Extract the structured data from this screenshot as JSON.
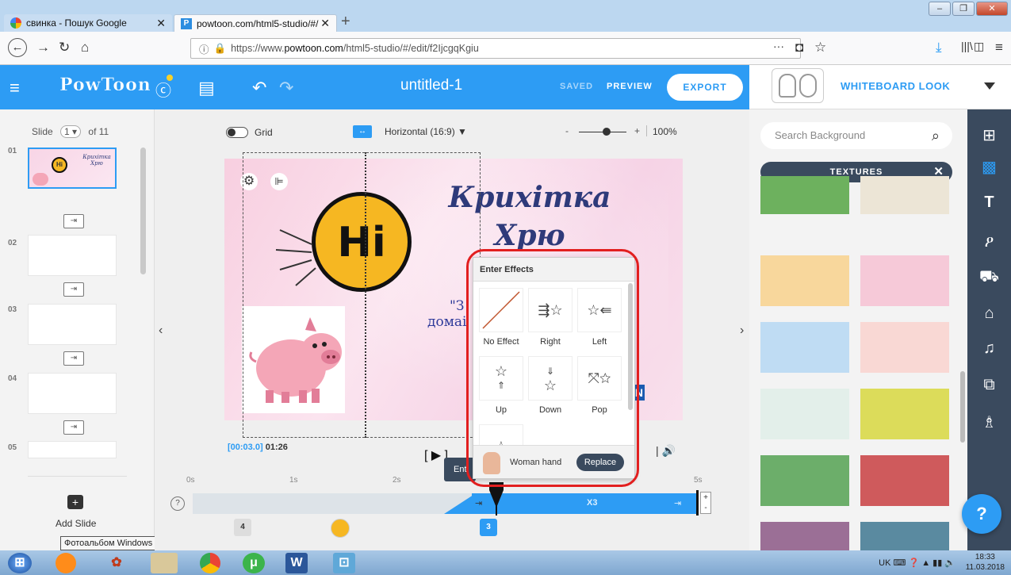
{
  "browser": {
    "tabs": [
      {
        "title": "свинка - Пошук Google"
      },
      {
        "title": "powtoon.com/html5-studio/#/"
      }
    ],
    "url_prefix": "https://www.",
    "url_domain": "powtoon.com",
    "url_path": "/html5-studio/#/edit/f2IjcgqKgiu",
    "new_tab": "+",
    "win_controls": [
      "–",
      "❐",
      "✕"
    ],
    "nav_icons": [
      "back-icon",
      "forward-icon",
      "reload-icon",
      "home-icon"
    ],
    "right_icons": [
      "···",
      "pocket-icon",
      "star-icon",
      "download-icon",
      "library-icon",
      "sidebar-icon",
      "menu-icon"
    ]
  },
  "header": {
    "logo": "PowToon",
    "title": "untitled-1",
    "saved": "SAVED",
    "preview": "PREVIEW",
    "export": "EXPORT",
    "look": "WHITEBOARD LOOK"
  },
  "slides": {
    "label": "Slide",
    "current": "1",
    "of": "of 11",
    "items": [
      "01",
      "02",
      "03",
      "04",
      "05"
    ],
    "add_label": "Add Slide",
    "tooltip": "Фотоальбом Windows Live"
  },
  "toolbar": {
    "grid": "Grid",
    "orientation": "Horizontal (16:9)",
    "zoom_minus": "-",
    "zoom_plus": "+",
    "zoom": "100%"
  },
  "slide": {
    "title_line1": "Крихітка",
    "title_line2": "Хрю",
    "hi": "Hi",
    "sub_line1": "\"З",
    "sub_line2": "домаі",
    "badge": "ON"
  },
  "timeline": {
    "timecode": "[00:03.0]",
    "duration": "01:26",
    "ticks": [
      "0s",
      "1s",
      "2s",
      "5s"
    ],
    "speed": "X3",
    "markers": [
      "4",
      "3"
    ],
    "help": "?"
  },
  "effects": {
    "header": "Enter Effects",
    "items": [
      {
        "label": "No Effect"
      },
      {
        "label": "Right"
      },
      {
        "label": "Left"
      },
      {
        "label": "Up"
      },
      {
        "label": "Down"
      },
      {
        "label": "Pop"
      }
    ],
    "hand_label": "Woman hand",
    "replace": "Replace",
    "tip": "Ent"
  },
  "background_panel": {
    "search_placeholder": "Search Background",
    "category": "TEXTURES",
    "swatches": [
      "#6db15e",
      "#ece5d6",
      "#f8d79c",
      "#f6c9d8",
      "#bfdcf3",
      "#f9d8d4",
      "#e3efea",
      "#dcdc5a",
      "#6cae6a",
      "#cf5a5c",
      "#9b6f96",
      "#5a8aa0"
    ]
  },
  "help_button": "?",
  "taskbar": {
    "lang": "UK",
    "time": "18:33",
    "date": "11.03.2018"
  },
  "colors": {
    "accent": "#2d9cf4",
    "dark": "#3a4a5e",
    "highlight": "#e21f1f"
  }
}
